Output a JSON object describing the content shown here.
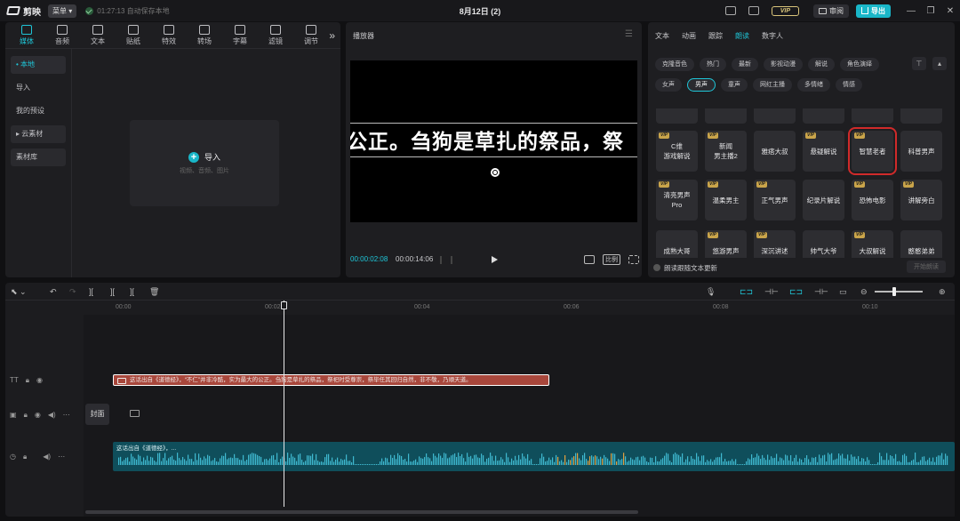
{
  "app": {
    "logo_text": "剪映",
    "menu_label": "菜单",
    "save_status": "01:27:13 自动保存本地",
    "doc_title": "8月12日 (2)",
    "vip_label": "VIP",
    "review_label": "审阅",
    "export_label": "导出",
    "win_min": "—",
    "win_max": "❐",
    "win_close": "✕"
  },
  "tools": [
    {
      "label": "媒体",
      "icon": "media-icon",
      "active": true
    },
    {
      "label": "音频",
      "icon": "audio-icon"
    },
    {
      "label": "文本",
      "icon": "text-icon"
    },
    {
      "label": "贴纸",
      "icon": "sticker-icon"
    },
    {
      "label": "特效",
      "icon": "effects-icon"
    },
    {
      "label": "转场",
      "icon": "transition-icon"
    },
    {
      "label": "字幕",
      "icon": "caption-icon"
    },
    {
      "label": "滤镜",
      "icon": "filter-icon"
    },
    {
      "label": "调节",
      "icon": "adjust-icon"
    }
  ],
  "tools_more": "»",
  "sidebar": {
    "items": [
      {
        "label": "• 本地",
        "selected": true
      },
      {
        "label": "导入"
      },
      {
        "label": "我的预设"
      },
      {
        "label": "▸ 云素材"
      },
      {
        "label": "素材库"
      }
    ]
  },
  "import": {
    "label": "导入",
    "hint": "视频、音频、图片"
  },
  "player": {
    "title": "播放器",
    "subtitle_text": "公正。刍狗是草扎的祭品，祭",
    "current_time": "00:00:02:08",
    "total_time": "00:00:14:06",
    "ratio_label": "比例"
  },
  "right_panel": {
    "tabs": [
      {
        "label": "文本"
      },
      {
        "label": "动画"
      },
      {
        "label": "跟踪"
      },
      {
        "label": "朗读",
        "active": true
      },
      {
        "label": "数字人"
      }
    ],
    "chips_row1": [
      {
        "label": "克隆音色"
      },
      {
        "label": "热门"
      },
      {
        "label": "最新"
      },
      {
        "label": "影视动漫"
      },
      {
        "label": "解说"
      },
      {
        "label": "角色演绎"
      }
    ],
    "chips_row2": [
      {
        "label": "女声"
      },
      {
        "label": "男声",
        "selected": true
      },
      {
        "label": "童声"
      },
      {
        "label": "网红主播"
      },
      {
        "label": "多情绪"
      },
      {
        "label": "情感"
      }
    ],
    "voices": [
      {
        "label": "",
        "vip": false
      },
      {
        "label": "",
        "vip": false
      },
      {
        "label": "",
        "vip": false
      },
      {
        "label": "",
        "vip": false
      },
      {
        "label": "",
        "vip": false
      },
      {
        "label": "",
        "vip": false
      },
      {
        "label": "C维\n游戏解说",
        "vip": true
      },
      {
        "label": "新闻\n男主播2",
        "vip": true
      },
      {
        "label": "雅痞大叔",
        "vip": false
      },
      {
        "label": "悬疑解说",
        "vip": true
      },
      {
        "label": "智慧老者",
        "vip": true,
        "selected": true
      },
      {
        "label": "科普男声",
        "vip": false
      },
      {
        "label": "清亮男声\nPro",
        "vip": true
      },
      {
        "label": "温柔男主",
        "vip": true
      },
      {
        "label": "正气男声",
        "vip": true
      },
      {
        "label": "纪录片解说",
        "vip": false
      },
      {
        "label": "恐怖电影",
        "vip": true
      },
      {
        "label": "讲解旁白",
        "vip": true
      },
      {
        "label": "成熟大哥",
        "vip": false
      },
      {
        "label": "悠游男声",
        "vip": true
      },
      {
        "label": "深沉讲述",
        "vip": true
      },
      {
        "label": "帅气大爷",
        "vip": false
      },
      {
        "label": "大叔解说",
        "vip": true
      },
      {
        "label": "憨憨弟弟",
        "vip": false
      }
    ],
    "update_toggle_label": "朗读跟随文本更新",
    "start_button": "开始朗读"
  },
  "timeline": {
    "ticks": [
      "00:00",
      "00:02",
      "00:04",
      "00:06",
      "00:08",
      "00:10"
    ],
    "cover_label": "封面",
    "text_clip": "这话出自《道德经》，“不仁”并非冷酷，实为最大的公正。刍狗是草扎的祭品，祭祀时受尊崇，祭毕任其回归自然，非不敬，乃顺天道。",
    "audio_clip": "这话出自《道德经》，..."
  }
}
